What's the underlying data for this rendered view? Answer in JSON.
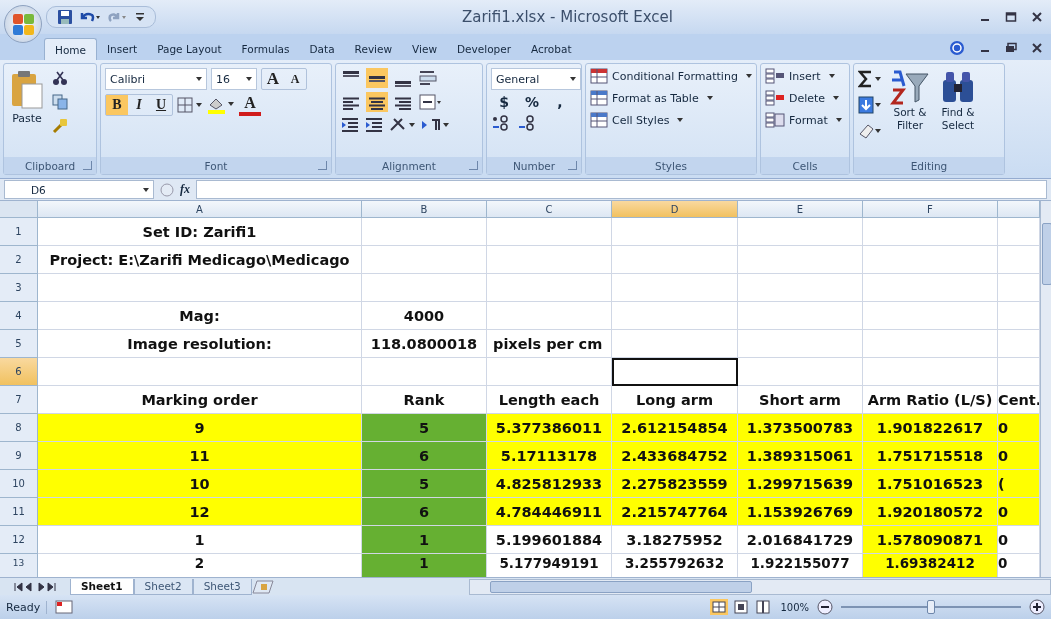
{
  "window": {
    "title": "Zarifi1.xlsx - Microsoft Excel"
  },
  "tabs": [
    {
      "label": "Home",
      "selected": true
    },
    {
      "label": "Insert",
      "selected": false
    },
    {
      "label": "Page Layout",
      "selected": false
    },
    {
      "label": "Formulas",
      "selected": false
    },
    {
      "label": "Data",
      "selected": false
    },
    {
      "label": "Review",
      "selected": false
    },
    {
      "label": "View",
      "selected": false
    },
    {
      "label": "Developer",
      "selected": false
    },
    {
      "label": "Acrobat",
      "selected": false
    }
  ],
  "ribbon": {
    "clipboard": {
      "label": "Clipboard",
      "paste": "Paste"
    },
    "font": {
      "label": "Font",
      "name": "Calibri",
      "size": "16",
      "grow": "A",
      "shrink": "A",
      "buttons": [
        {
          "label": "B",
          "selected": true
        },
        {
          "label": "I",
          "selected": false
        },
        {
          "label": "U",
          "selected": false
        }
      ],
      "color_button": "A"
    },
    "alignment": {
      "label": "Alignment",
      "vertical": [
        {
          "selected": false
        },
        {
          "selected": true
        },
        {
          "selected": false
        }
      ],
      "horizontal": [
        {
          "selected": false
        },
        {
          "selected": true
        },
        {
          "selected": false
        }
      ]
    },
    "number": {
      "label": "Number",
      "format": "General",
      "symbols": [
        "$",
        "%",
        ","
      ]
    },
    "styles": {
      "label": "Styles",
      "items": [
        "Conditional Formatting",
        "Format as Table",
        "Cell Styles"
      ]
    },
    "cells": {
      "label": "Cells",
      "items": [
        "Insert",
        "Delete",
        "Format"
      ]
    },
    "editing": {
      "label": "Editing",
      "items": [
        [
          "Sort &",
          "Filter"
        ],
        [
          "Find &",
          "Select"
        ]
      ]
    }
  },
  "formula_bar": {
    "name_box": "D6",
    "fx": "fx"
  },
  "grid": {
    "columns": [
      {
        "label": "A",
        "selected": false
      },
      {
        "label": "B",
        "selected": false
      },
      {
        "label": "C",
        "selected": false
      },
      {
        "label": "D",
        "selected": true
      },
      {
        "label": "E",
        "selected": false
      },
      {
        "label": "F",
        "selected": false
      },
      {
        "selected": false
      }
    ],
    "rows": [
      {
        "num": "1",
        "selected": false,
        "cells": [
          {
            "text": "Set ID: Zarifi1"
          },
          {},
          {},
          {},
          {},
          {},
          {}
        ]
      },
      {
        "num": "2",
        "selected": false,
        "cells": [
          {
            "text": "Project: E:\\Zarifi Medicago\\Medicago"
          },
          {},
          {},
          {},
          {},
          {},
          {}
        ]
      },
      {
        "num": "3",
        "selected": false,
        "cells": [
          {},
          {},
          {},
          {},
          {},
          {},
          {}
        ]
      },
      {
        "num": "4",
        "selected": false,
        "cells": [
          {
            "text": "Mag:"
          },
          {
            "text": "4000"
          },
          {},
          {},
          {},
          {},
          {}
        ]
      },
      {
        "num": "5",
        "selected": false,
        "cells": [
          {
            "text": "Image resolution:"
          },
          {
            "text": "118.0800018"
          },
          {
            "text": "pixels per cm"
          },
          {},
          {},
          {},
          {}
        ]
      },
      {
        "num": "6",
        "selected": true,
        "cells": [
          {},
          {},
          {},
          {},
          {},
          {},
          {}
        ]
      },
      {
        "num": "7",
        "selected": false,
        "cells": [
          {
            "text": "Marking order"
          },
          {
            "text": "Rank"
          },
          {
            "text": "Length each"
          },
          {
            "text": "Long arm"
          },
          {
            "text": "Short arm"
          },
          {
            "text": "Arm Ratio (L/S)"
          },
          {
            "text": "Cent."
          }
        ]
      },
      {
        "num": "8",
        "selected": false,
        "cells": [
          {
            "text": "9",
            "color": "#ffff00"
          },
          {
            "text": "5",
            "color": "#66b032"
          },
          {
            "text": "5.377386011",
            "color": "#ffff00"
          },
          {
            "text": "2.612154854",
            "color": "#ffff00"
          },
          {
            "text": "1.373500783",
            "color": "#ffff00"
          },
          {
            "text": "1.901822617",
            "color": "#ffff00"
          },
          {
            "text": "0",
            "color": "#ffff00"
          }
        ]
      },
      {
        "num": "9",
        "selected": false,
        "cells": [
          {
            "text": "11",
            "color": "#ffff00"
          },
          {
            "text": "6",
            "color": "#66b032"
          },
          {
            "text": "5.17113178",
            "color": "#ffff00"
          },
          {
            "text": "2.433684752",
            "color": "#ffff00"
          },
          {
            "text": "1.389315061",
            "color": "#ffff00"
          },
          {
            "text": "1.751715518",
            "color": "#ffff00"
          },
          {
            "text": "0",
            "color": "#ffff00"
          }
        ]
      },
      {
        "num": "10",
        "selected": false,
        "cells": [
          {
            "text": "10",
            "color": "#ffff00"
          },
          {
            "text": "5",
            "color": "#66b032"
          },
          {
            "text": "4.825812933",
            "color": "#ffff00"
          },
          {
            "text": "2.275823559",
            "color": "#ffff00"
          },
          {
            "text": "1.299715639",
            "color": "#ffff00"
          },
          {
            "text": "1.751016523",
            "color": "#ffff00"
          },
          {
            "text": "(",
            "color": "#ffff00"
          }
        ]
      },
      {
        "num": "11",
        "selected": false,
        "cells": [
          {
            "text": "12",
            "color": "#ffff00"
          },
          {
            "text": "6",
            "color": "#66b032"
          },
          {
            "text": "4.784446911",
            "color": "#ffff00"
          },
          {
            "text": "2.215747764",
            "color": "#ffff00"
          },
          {
            "text": "1.153926769",
            "color": "#ffff00"
          },
          {
            "text": "1.920180572",
            "color": "#ffff00"
          },
          {
            "text": "0",
            "color": "#ffff00"
          }
        ]
      },
      {
        "num": "12",
        "selected": false,
        "cells": [
          {
            "text": "1"
          },
          {
            "text": "1",
            "color": "#66b032"
          },
          {
            "text": "5.199601884"
          },
          {
            "text": "3.18275952"
          },
          {
            "text": "2.016841729"
          },
          {
            "text": "1.578090871",
            "color": "#ffff00"
          },
          {
            "text": "0"
          }
        ]
      },
      {
        "num": "13",
        "selected": false,
        "cells": [
          {
            "text": "2"
          },
          {
            "text": "1",
            "color": "#66b032"
          },
          {
            "text": "5.177949191"
          },
          {
            "text": "3.255792632"
          },
          {
            "text": "1.922155077"
          },
          {
            "text": "1.69382412",
            "color": "#ffff00"
          },
          {
            "text": "0"
          }
        ]
      }
    ]
  },
  "sheet_tabs": [
    {
      "label": "Sheet1",
      "selected": true
    },
    {
      "label": "Sheet2",
      "selected": false
    },
    {
      "label": "Sheet3",
      "selected": false
    }
  ],
  "status_bar": {
    "status": "Ready",
    "zoom": "100%",
    "zoom_slider": {
      "level": 0.5
    }
  }
}
